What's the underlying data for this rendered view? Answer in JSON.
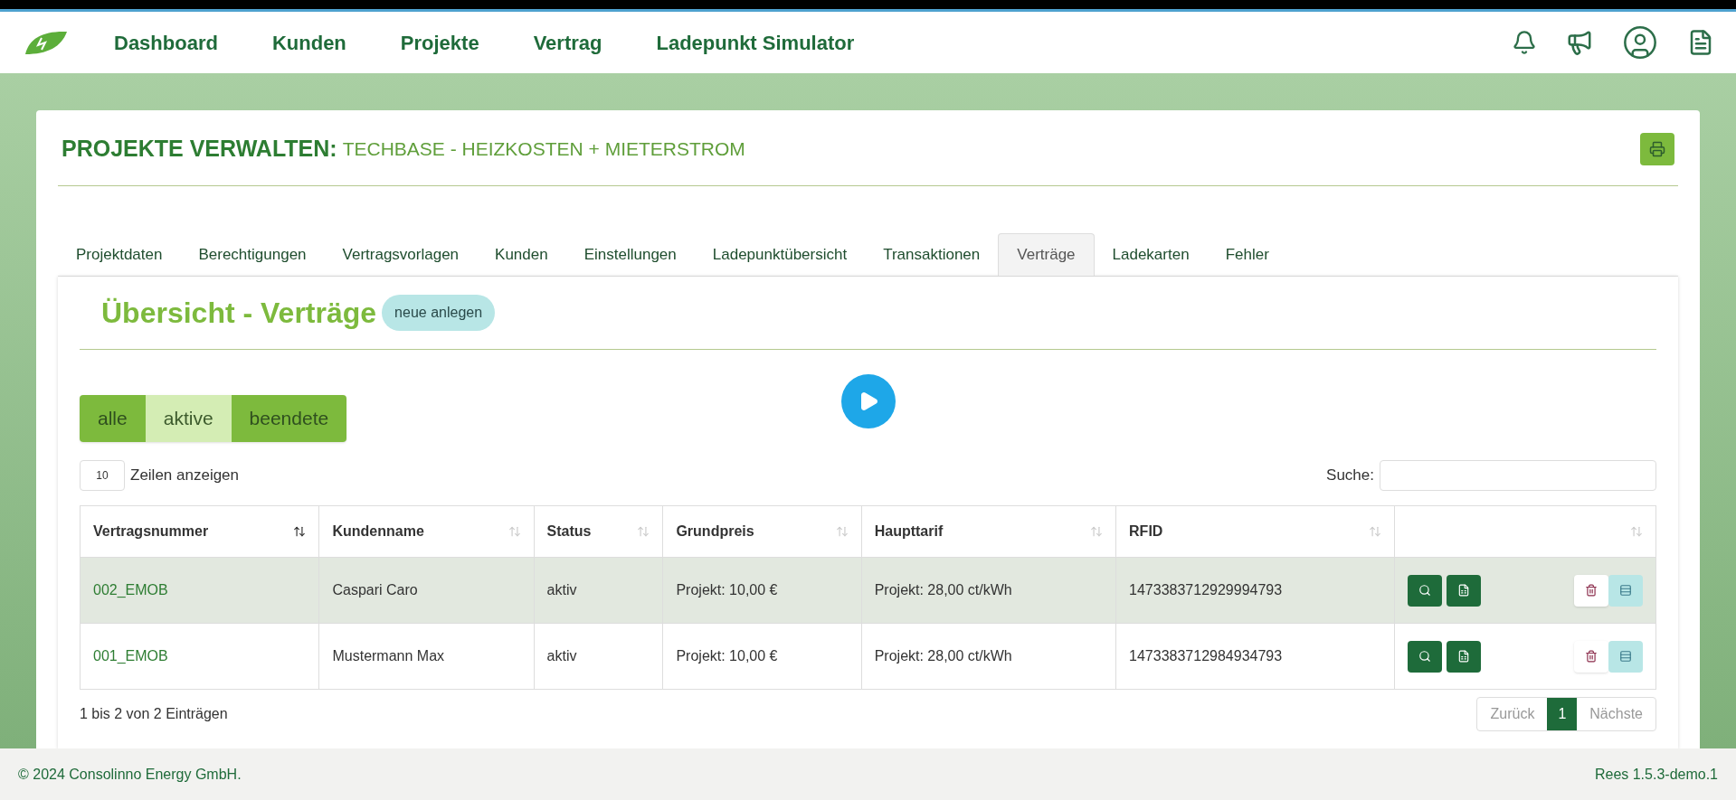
{
  "nav": {
    "items": [
      {
        "label": "Dashboard"
      },
      {
        "label": "Kunden"
      },
      {
        "label": "Projekte"
      },
      {
        "label": "Vertrag"
      },
      {
        "label": "Ladepunkt Simulator"
      }
    ]
  },
  "page_title": {
    "label": "PROJEKTE VERWALTEN:",
    "project": "TECHBASE - HEIZKOSTEN + MIETERSTROM"
  },
  "tabs": [
    {
      "label": "Projektdaten",
      "selected": false
    },
    {
      "label": "Berechtigungen",
      "selected": false
    },
    {
      "label": "Vertragsvorlagen",
      "selected": false
    },
    {
      "label": "Kunden",
      "selected": false
    },
    {
      "label": "Einstellungen",
      "selected": false
    },
    {
      "label": "Ladepunktübersicht",
      "selected": false
    },
    {
      "label": "Transaktionen",
      "selected": false
    },
    {
      "label": "Verträge",
      "selected": true
    },
    {
      "label": "Ladekarten",
      "selected": false
    },
    {
      "label": "Fehler",
      "selected": false
    }
  ],
  "section": {
    "title": "Übersicht - Verträge",
    "new_button": "neue anlegen"
  },
  "filters": [
    {
      "label": "alle",
      "selected": false
    },
    {
      "label": "aktive",
      "selected": true
    },
    {
      "label": "beendete",
      "selected": false
    }
  ],
  "page_length": {
    "value": "10",
    "label": "Zeilen anzeigen"
  },
  "search": {
    "label": "Suche:"
  },
  "table": {
    "columns": [
      {
        "label": "Vertragsnummer",
        "sorted": true
      },
      {
        "label": "Kundenname",
        "sorted": false
      },
      {
        "label": "Status",
        "sorted": false
      },
      {
        "label": "Grundpreis",
        "sorted": false
      },
      {
        "label": "Haupttarif",
        "sorted": false
      },
      {
        "label": "RFID",
        "sorted": false
      },
      {
        "sorted": false
      }
    ],
    "rows": [
      {
        "highlighted": true,
        "cells": [
          "002_EMOB",
          "Caspari Caro",
          "aktiv",
          "Projekt: 10,00 €",
          "Projekt: 28,00 ct/kWh",
          "1473383712929994793"
        ]
      },
      {
        "highlighted": false,
        "cells": [
          "001_EMOB",
          "Mustermann Max",
          "aktiv",
          "Projekt: 10,00 €",
          "Projekt: 28,00 ct/kWh",
          "1473383712984934793"
        ]
      }
    ]
  },
  "info": "1 bis 2 von 2 Einträgen",
  "pagination": {
    "previous": "Zurück",
    "pages": [
      {
        "label": "1",
        "selected": true
      }
    ],
    "next": "Nächste"
  },
  "footer": {
    "copyright": "© 2024 Consolinno Energy GmbH.",
    "version": "Rees 1.5.3-demo.1"
  }
}
